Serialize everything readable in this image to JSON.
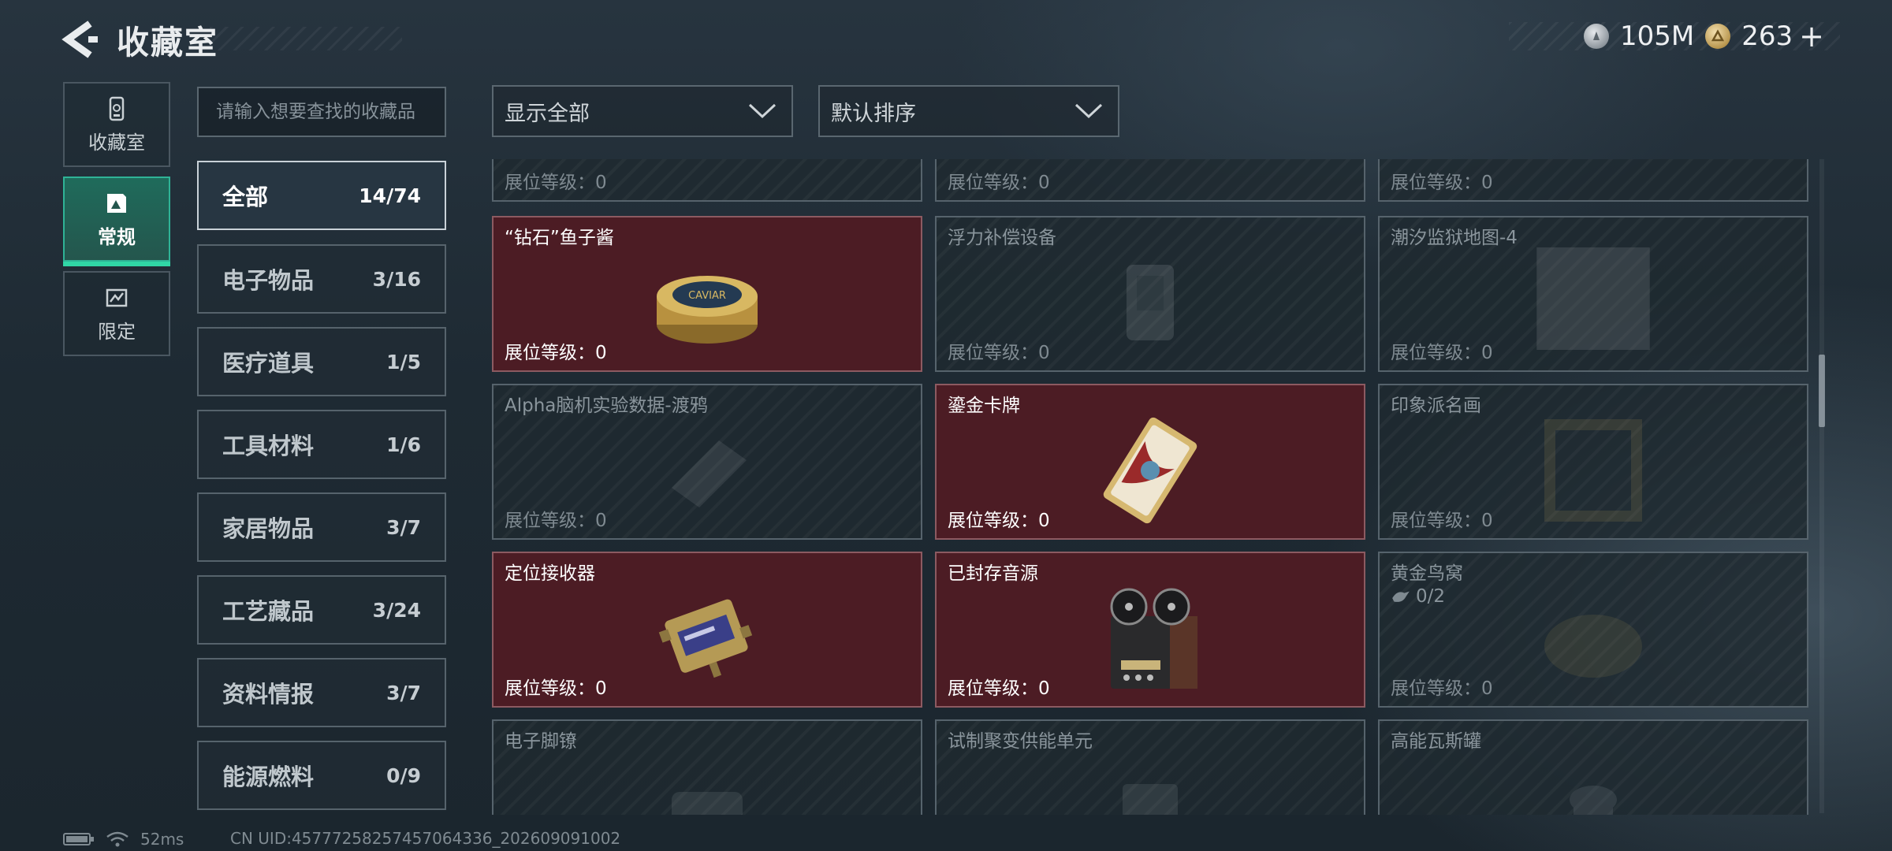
{
  "header": {
    "title": "收藏室",
    "currencies": [
      {
        "icon": "silver-coin-icon",
        "value": "105M"
      },
      {
        "icon": "gold-coin-icon",
        "value": "263"
      }
    ],
    "add_label": "+"
  },
  "side_tabs": [
    {
      "label": "收藏室",
      "icon": "collection-room-icon",
      "active": false
    },
    {
      "label": "常规",
      "icon": "regular-icon",
      "active": true
    },
    {
      "label": "限定",
      "icon": "limited-icon",
      "active": false
    }
  ],
  "search": {
    "placeholder": "请输入想要查找的收藏品"
  },
  "filters": {
    "show_label": "显示全部",
    "sort_label": "默认排序"
  },
  "categories": [
    {
      "label": "全部",
      "count": "14/74",
      "active": true
    },
    {
      "label": "电子物品",
      "count": "3/16"
    },
    {
      "label": "医疗道具",
      "count": "1/5"
    },
    {
      "label": "工具材料",
      "count": "1/6"
    },
    {
      "label": "家居物品",
      "count": "3/7"
    },
    {
      "label": "工艺藏品",
      "count": "3/24"
    },
    {
      "label": "资料情报",
      "count": "3/7"
    },
    {
      "label": "能源燃料",
      "count": "0/9"
    }
  ],
  "level_label": "展位等级：",
  "cards": [
    {
      "name": "",
      "level": "0",
      "owned": false
    },
    {
      "name": "",
      "level": "0",
      "owned": false
    },
    {
      "name": "",
      "level": "0",
      "owned": false
    },
    {
      "name": "“钻石”鱼子酱",
      "level": "0",
      "owned": true,
      "art": "caviar-tin-icon"
    },
    {
      "name": "浮力补偿设备",
      "level": "0",
      "owned": false,
      "art": "buoyancy-device-icon"
    },
    {
      "name": "潮汐监狱地图-4",
      "level": "0",
      "owned": false,
      "art": "map-icon"
    },
    {
      "name": "Alpha脑机实验数据-渡鸦",
      "level": "0",
      "owned": false,
      "art": "data-device-icon"
    },
    {
      "name": "鎏金卡牌",
      "level": "0",
      "owned": true,
      "art": "gilded-card-icon"
    },
    {
      "name": "印象派名画",
      "level": "0",
      "owned": false,
      "art": "painting-icon"
    },
    {
      "name": "定位接收器",
      "level": "0",
      "owned": true,
      "art": "locator-receiver-icon"
    },
    {
      "name": "已封存音源",
      "level": "0",
      "owned": true,
      "art": "reel-recorder-icon"
    },
    {
      "name": "黄金鸟窝",
      "level": "0",
      "owned": false,
      "art": "golden-nest-icon",
      "progress": "0/2"
    },
    {
      "name": "电子脚镣",
      "owned": false,
      "art": "ankle-monitor-icon"
    },
    {
      "name": "试制聚变供能单元",
      "owned": false,
      "art": "fusion-unit-icon"
    },
    {
      "name": "高能瓦斯罐",
      "owned": false,
      "art": "gas-tank-icon"
    }
  ],
  "footer": {
    "ping": "52ms",
    "uid": "CN UID:457772582574570643​36_202609091002"
  }
}
